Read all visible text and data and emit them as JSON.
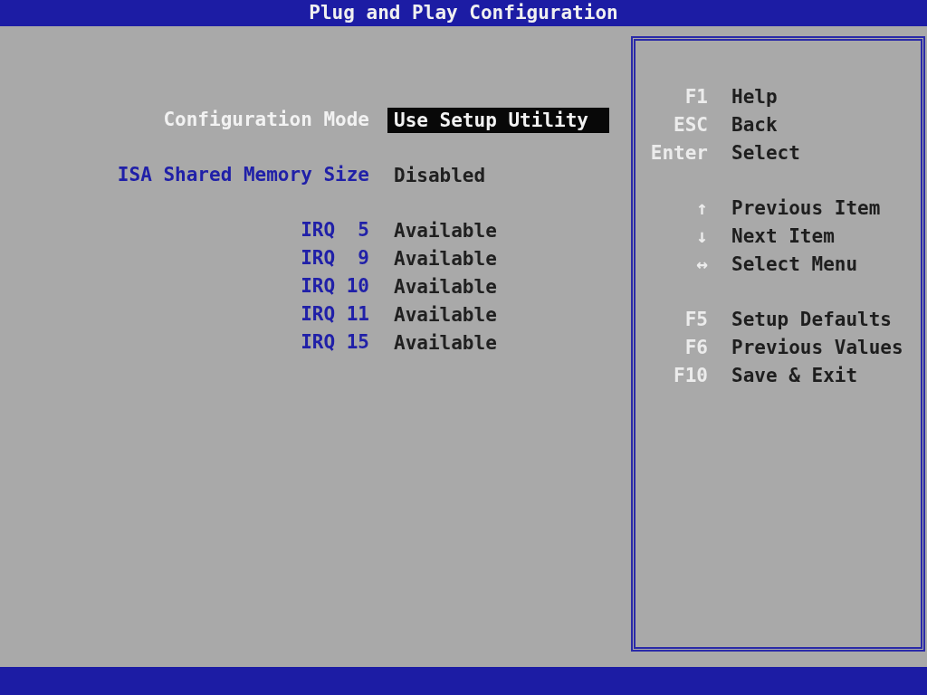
{
  "title": "Plug and Play Configuration",
  "setting_groups": [
    [
      {
        "label": "Configuration Mode",
        "value": "Use Setup Utility",
        "selected": true
      }
    ],
    [
      {
        "label": "ISA Shared Memory Size",
        "value": "Disabled",
        "selected": false
      }
    ],
    [
      {
        "label": "IRQ  5",
        "value": "Available",
        "selected": false
      },
      {
        "label": "IRQ  9",
        "value": "Available",
        "selected": false
      },
      {
        "label": "IRQ 10",
        "value": "Available",
        "selected": false
      },
      {
        "label": "IRQ 11",
        "value": "Available",
        "selected": false
      },
      {
        "label": "IRQ 15",
        "value": "Available",
        "selected": false
      }
    ]
  ],
  "help_groups": [
    [
      {
        "key": "F1",
        "action": "Help"
      },
      {
        "key": "ESC",
        "action": "Back"
      },
      {
        "key": "Enter",
        "action": "Select"
      }
    ],
    [
      {
        "key": "↑",
        "action": "Previous Item"
      },
      {
        "key": "↓",
        "action": "Next Item"
      },
      {
        "key": "↔",
        "action": "Select Menu"
      }
    ],
    [
      {
        "key": "F5",
        "action": "Setup Defaults"
      },
      {
        "key": "F6",
        "action": "Previous Values"
      },
      {
        "key": "F10",
        "action": "Save & Exit"
      }
    ]
  ]
}
